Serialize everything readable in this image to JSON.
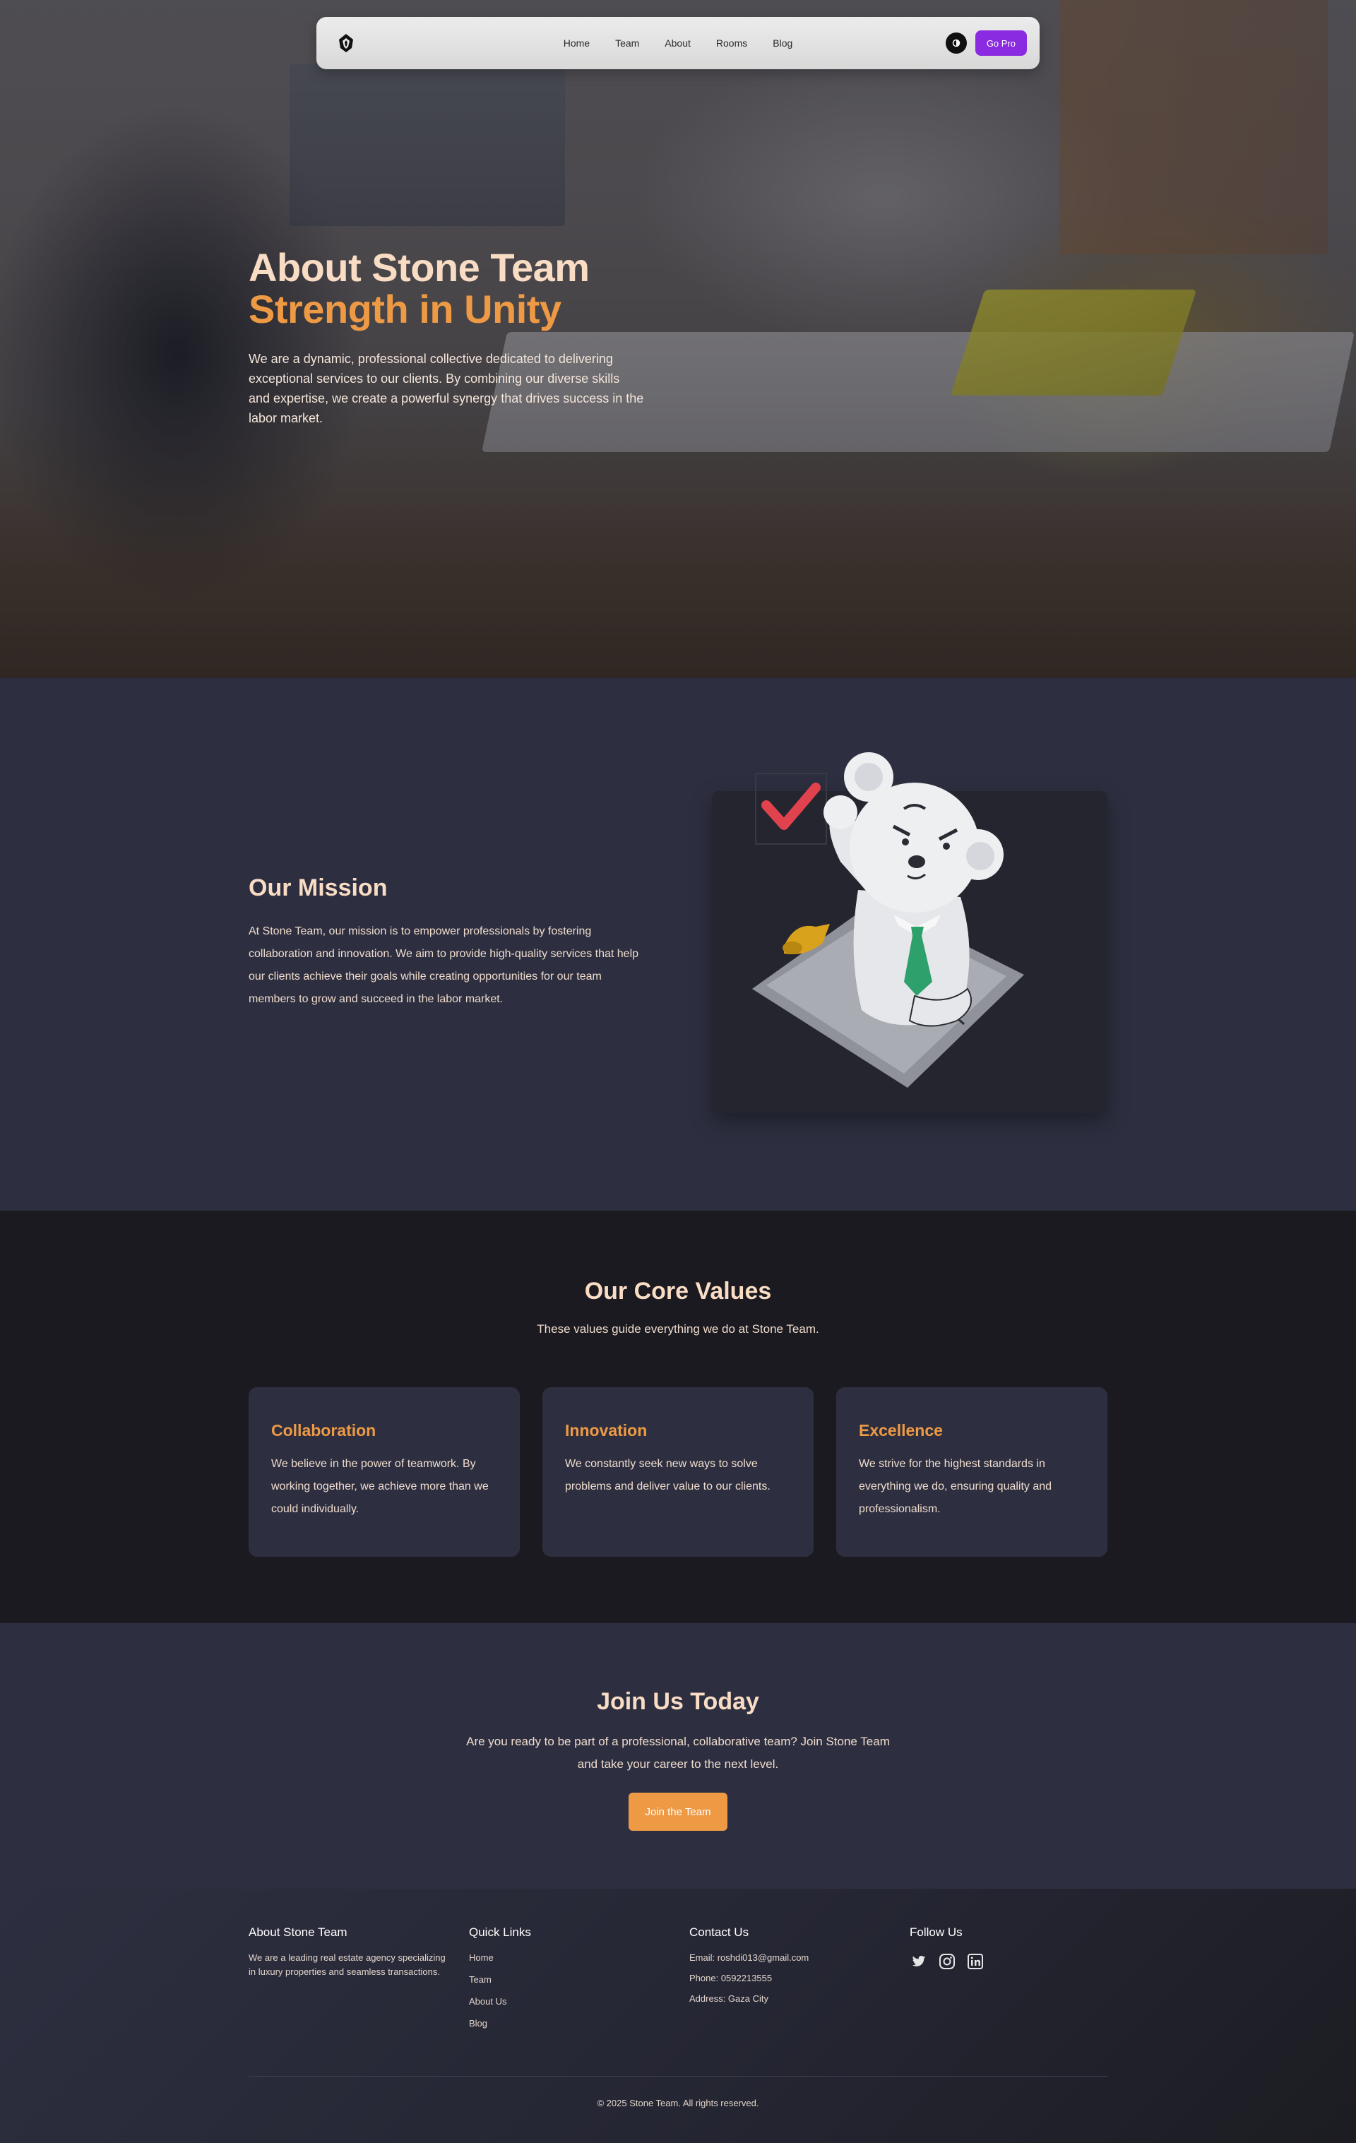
{
  "nav": {
    "links": [
      "Home",
      "Team",
      "About",
      "Rooms",
      "Blog"
    ],
    "cta": "Go Pro"
  },
  "hero": {
    "title": "About Stone Team",
    "subtitle": "Strength in Unity",
    "text": "We are a dynamic, professional collective dedicated to delivering exceptional services to our clients. By combining our diverse skills and expertise, we create a powerful synergy that drives success in the labor market."
  },
  "mission": {
    "title": "Our Mission",
    "text": "At Stone Team, our mission is to empower professionals by fostering collaboration and innovation. We aim to provide high-quality services that help our clients achieve their goals while creating opportunities for our team members to grow and succeed in the labor market."
  },
  "values": {
    "title": "Our Core Values",
    "subtitle": "These values guide everything we do at Stone Team.",
    "cards": [
      {
        "title": "Collaboration",
        "text": "We believe in the power of teamwork. By working together, we achieve more than we could individually."
      },
      {
        "title": "Innovation",
        "text": "We constantly seek new ways to solve problems and deliver value to our clients."
      },
      {
        "title": "Excellence",
        "text": "We strive for the highest standards in everything we do, ensuring quality and professionalism."
      }
    ]
  },
  "join": {
    "title": "Join Us Today",
    "text": "Are you ready to be part of a professional, collaborative team? Join Stone Team and take your career to the next level.",
    "button": "Join the Team"
  },
  "footer": {
    "about_title": "About Stone Team",
    "about_text": "We are a leading real estate agency specializing in luxury properties and seamless transactions.",
    "links_title": "Quick Links",
    "links": [
      "Home",
      "Team",
      "About Us",
      "Blog"
    ],
    "contact_title": "Contact Us",
    "email": "Email: roshdi013@gmail.com",
    "phone": "Phone: 0592213555",
    "address": "Address: Gaza City",
    "follow_title": "Follow Us",
    "socials": [
      "twitter-icon",
      "instagram-icon",
      "linkedin-icon"
    ],
    "copyright": "© 2025 Stone Team. All rights reserved."
  },
  "colors": {
    "accent": "#ee9a45",
    "heading": "#f9dcc4",
    "brand_purple": "#8a2be2",
    "bg_dark": "#2d2f40",
    "bg_darker": "#1a1a20"
  }
}
